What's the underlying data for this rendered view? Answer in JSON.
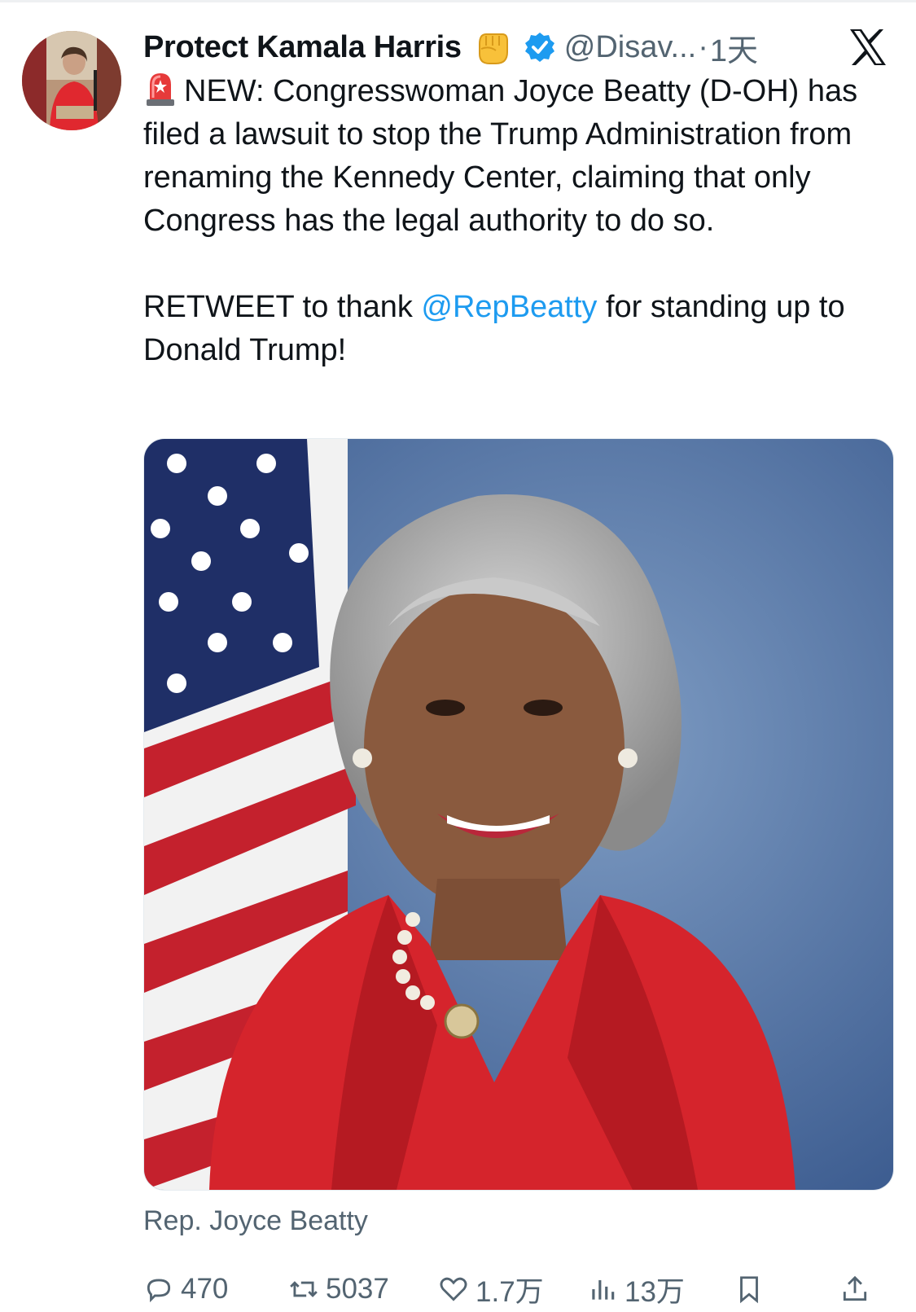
{
  "tweet": {
    "author": {
      "display_name": "Protect Kamala Harris",
      "handle": "@Disav...",
      "time_sep": "·",
      "time": "1天",
      "badges": [
        "raised-fist-emoji",
        "verified-badge"
      ]
    },
    "text": {
      "siren": "rotating-light-emoji",
      "paragraph1": "NEW: Congresswoman Joyce Beatty (D-OH) has filed a lawsuit to stop the Trump Administration from renaming the Kennedy Center, claiming that only Congress has the legal authority to do so.",
      "p2_before": "RETWEET to thank ",
      "p2_mention": "@RepBeatty",
      "p2_after": " for standing up to Donald Trump!"
    },
    "media": {
      "caption": "Rep. Joyce Beatty"
    },
    "stats": {
      "replies": "470",
      "retweets": "5037",
      "likes": "1.7万",
      "views": "13万"
    }
  },
  "colors": {
    "text": "#0f1419",
    "secondary": "#536471",
    "link": "#1d9bf0",
    "verified": "#1d9bf0",
    "jacket": "#d5242c"
  },
  "icons": [
    "x-logo-icon",
    "reply-icon",
    "retweet-icon",
    "like-icon",
    "views-icon",
    "bookmark-icon",
    "share-icon"
  ]
}
